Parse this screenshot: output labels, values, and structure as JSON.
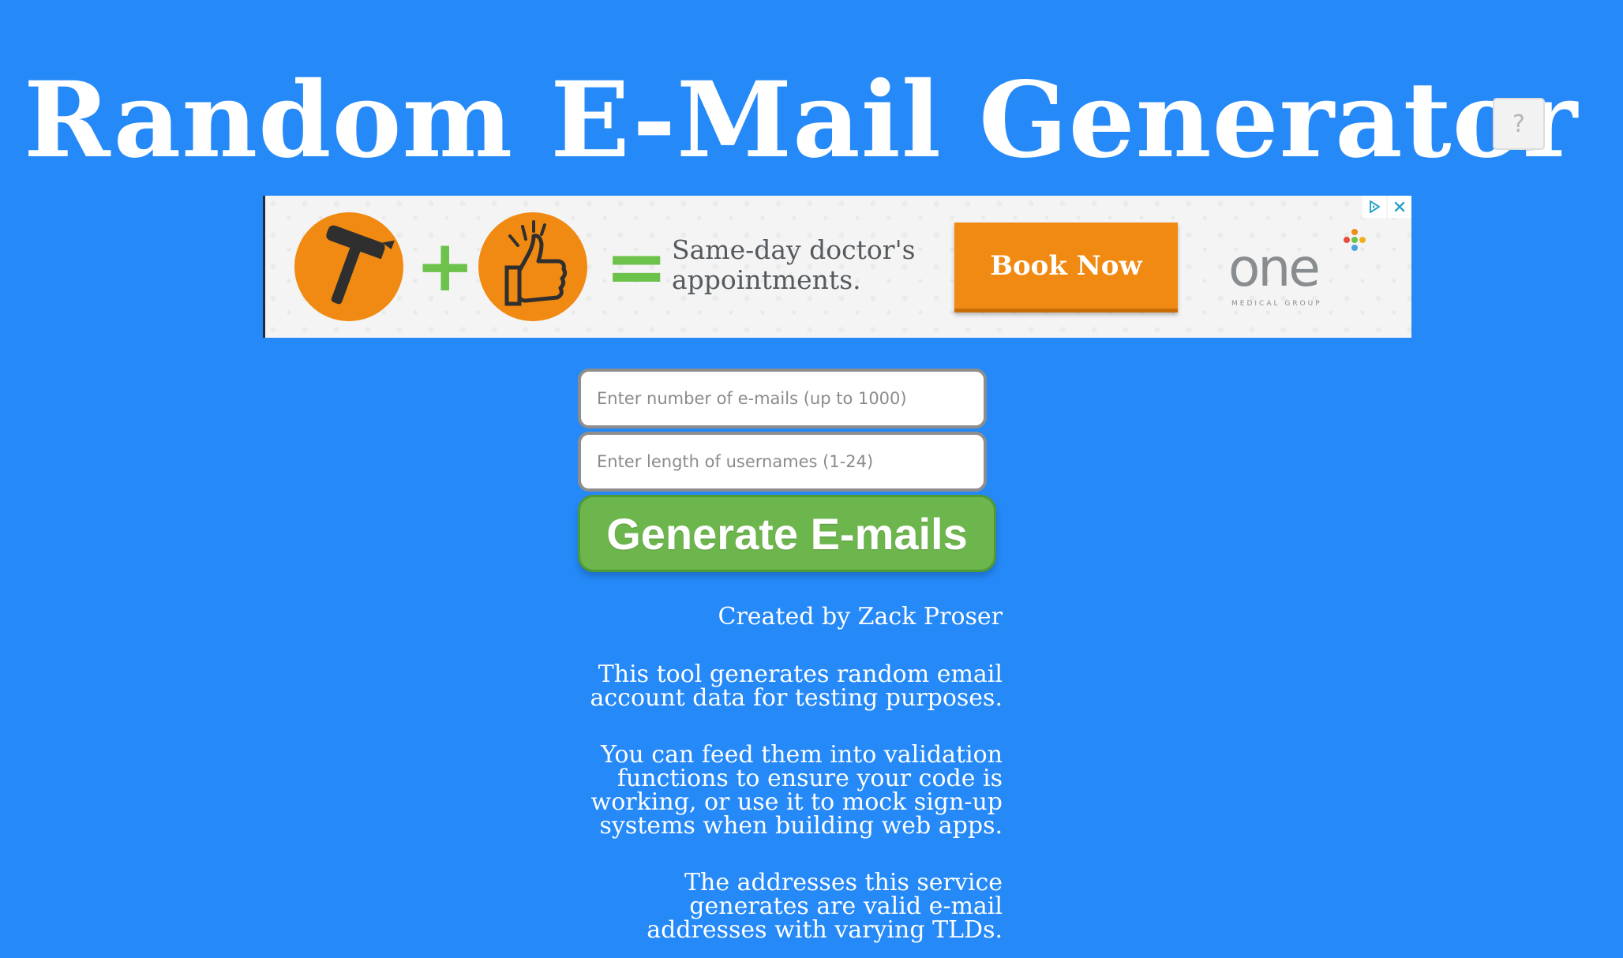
{
  "header": {
    "title": "Random E-Mail Generator",
    "help_label": "?"
  },
  "ad": {
    "text_lines": [
      "Same-day doctor's",
      "appointments."
    ],
    "cta_label": "Book Now",
    "brand_word": "one",
    "brand_sub": "MEDICAL GROUP",
    "plus": "+",
    "equals": "=",
    "icons": [
      "hammer-icon",
      "thumbs-up-icon",
      "adchoices-icon",
      "close-icon"
    ]
  },
  "form": {
    "count_placeholder": "Enter number of e-mails (up to 1000)",
    "length_placeholder": "Enter length of usernames (1-24)",
    "generate_label": "Generate E-mails"
  },
  "info": {
    "credit": "Created by Zack Proser",
    "p1": [
      "This tool generates random email",
      "account data for testing purposes."
    ],
    "p2": [
      "You can feed them into validation",
      "functions to ensure your code is",
      "working, or use it to mock sign-up",
      "systems when building web apps."
    ],
    "p3": [
      "The addresses this service",
      "generates are valid e-mail",
      "addresses with varying TLDs."
    ]
  },
  "colors": {
    "background": "#2589f8",
    "button_green": "#6db54d",
    "ad_orange": "#f08a12",
    "ad_green": "#6cc24a"
  }
}
